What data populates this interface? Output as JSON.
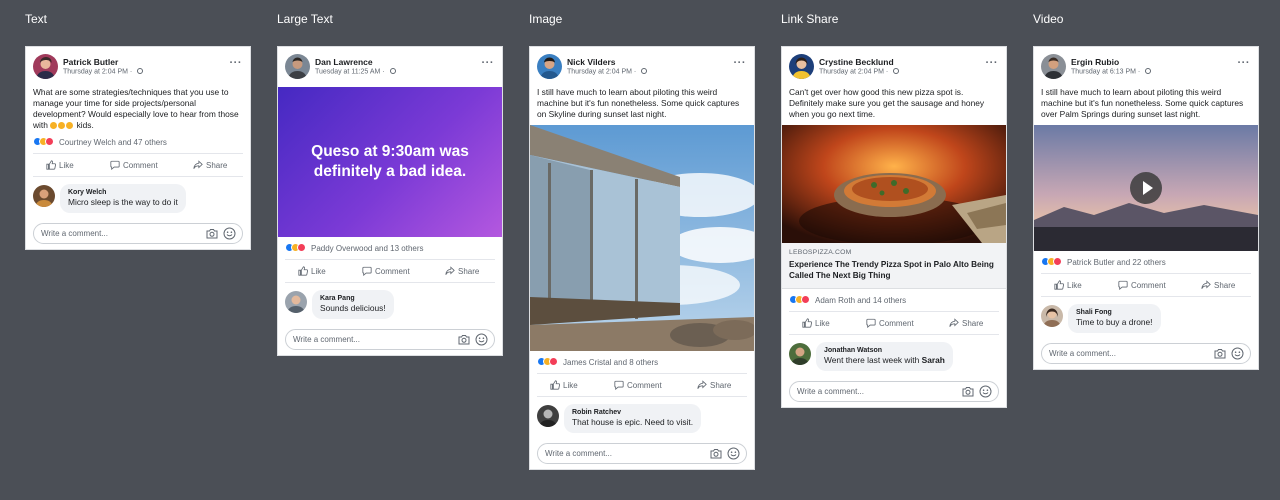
{
  "actions": {
    "like": "Like",
    "comment": "Comment",
    "share": "Share"
  },
  "write_comment_placeholder": "Write a comment...",
  "columns": [
    {
      "title": "Text",
      "post": {
        "author": "Patrick Butler",
        "timestamp": "Thursday at 2:04 PM",
        "text": "What are some strategies/techniques that you use to manage your time for side projects/personal development? Would especially love to hear from those with",
        "text_suffix": "kids.",
        "reactions": "Courtney Welch and 47 others"
      },
      "comment": {
        "author": "Kory Welch",
        "text": "Micro sleep is the way to do it"
      }
    },
    {
      "title": "Large Text",
      "post": {
        "author": "Dan Lawrence",
        "timestamp": "Tuesday at 11:25 AM",
        "large_text": "Queso at 9:30am was definitely a bad idea.",
        "reactions": "Paddy Overwood and 13 others"
      },
      "comment": {
        "author": "Kara Pang",
        "text": "Sounds delicious!"
      }
    },
    {
      "title": "Image",
      "post": {
        "author": "Nick Vilders",
        "timestamp": "Thursday at 2:04 PM",
        "text": "I still have much to learn about piloting this weird machine but it's fun nonetheless. Some quick captures on Skyline during sunset last night.",
        "reactions": "James Cristal and 8 others"
      },
      "comment": {
        "author": "Robin Ratchev",
        "text": "That house is epic. Need to visit."
      }
    },
    {
      "title": "Link Share",
      "post": {
        "author": "Crystine Becklund",
        "timestamp": "Thursday at 2:04 PM",
        "text": "Can't get over how good this new pizza spot is. Definitely make sure you get the sausage and honey when you go next time.",
        "link_domain": "LEBOSPIZZA.COM",
        "link_title": "Experience The Trendy Pizza Spot in Palo Alto Being Called The Next Big Thing",
        "reactions": "Adam Roth and 14 others"
      },
      "comment": {
        "author": "Jonathan Watson",
        "text": "Went there last week with",
        "mention": "Sarah"
      }
    },
    {
      "title": "Video",
      "post": {
        "author": "Ergin Rubio",
        "timestamp": "Thursday at 6:13 PM",
        "text": "I still have much to learn about piloting this weird machine but it's fun nonetheless. Some quick captures over Palm Springs during sunset last night.",
        "reactions": "Patrick Butler and 22 others"
      },
      "comment": {
        "author": "Shali Fong",
        "text": "Time to buy a drone!"
      }
    }
  ],
  "colors": {
    "background": "#4b4f56",
    "like_blue": "#1877f2",
    "love_red": "#f33e58",
    "wow_yellow": "#f7b125",
    "secondary_text": "#606770"
  },
  "icons": [
    "like-icon",
    "comment-icon",
    "share-icon",
    "camera-icon",
    "emoji-icon",
    "globe-icon",
    "more-icon",
    "play-icon"
  ]
}
